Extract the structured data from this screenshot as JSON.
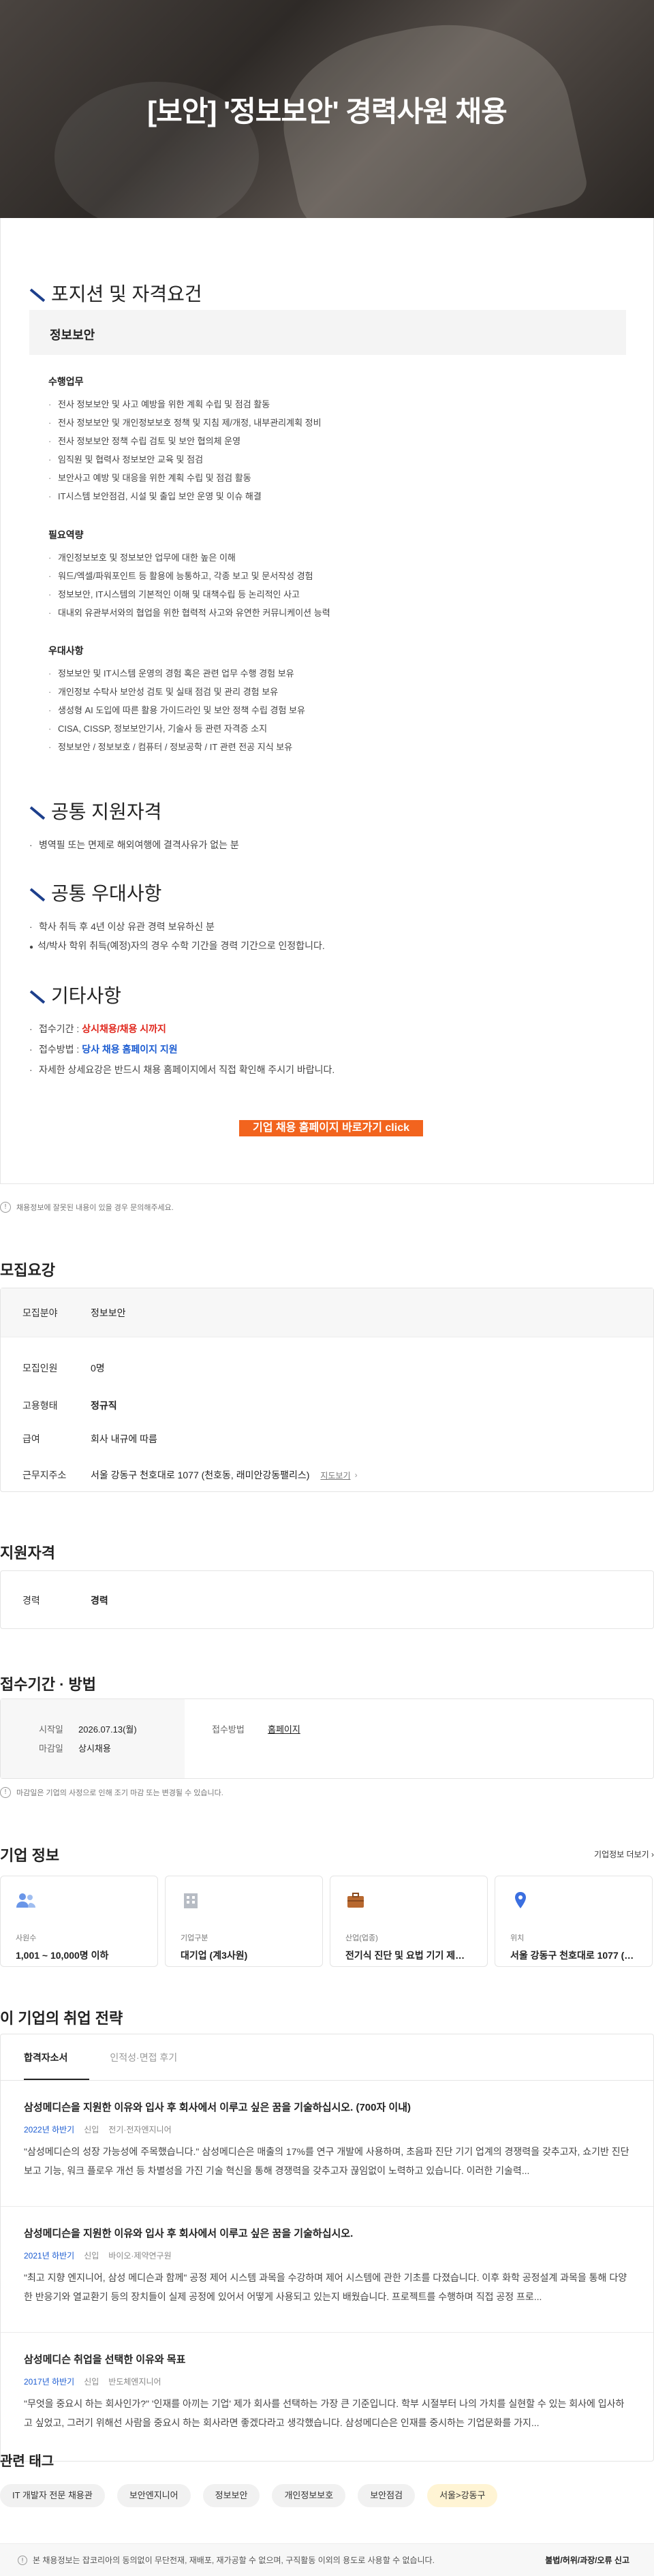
{
  "hero": {
    "title": "[보안] '정보보안' 경력사원 채용"
  },
  "jd": {
    "position_title": "포지션 및 자격요건",
    "position_name": "정보보안",
    "groups": [
      {
        "title": "수행업무",
        "items": [
          "전사 정보보안 및 사고 예방을 위한 계획 수립 및 점검 활동",
          "전사 정보보안 및 개인정보보호 정책 및 지침 제/개정, 내부관리계획 정비",
          "전사 정보보안 정책 수립 검토 및 보안 협의체 운영",
          "임직원 및 협력사 정보보안 교육 및 점검",
          "보안사고 예방 및 대응을 위한 계획 수립 및 점검 활동",
          "IT시스템 보안점검, 시설 및 출입 보안 운영 및 이슈 해결"
        ]
      },
      {
        "title": "필요역량",
        "items": [
          "개인정보보호 및 정보보안 업무에 대한 높은 이해",
          "워드/엑셀/파워포인트 등 활용에 능통하고, 각종 보고 및 문서작성 경험",
          "정보보안, IT시스템의 기본적인 이해 및 대책수립 등 논리적인 사고",
          "대내외 유관부서와의 협업을 위한 협력적 사고와 유연한 커뮤니케이션 능력"
        ]
      },
      {
        "title": "우대사항",
        "items": [
          "정보보안 및 IT시스템 운영의 경험 혹은 관련 업무 수행 경험 보유",
          "개인정보 수탁사 보안성 검토 및 실태 점검 및 관리 경험 보유",
          "생성형 AI 도입에 따른 활용 가이드라인 및 보안 정책 수립 경험 보유",
          "CISA, CISSP, 정보보안기사, 기술사 등 관련 자격증 소지",
          "정보보안 / 정보보호 / 컴퓨터 / 정보공학 / IT 관련 전공 지식 보유"
        ]
      }
    ],
    "common_req_title": "공통 지원자격",
    "common_req_items": [
      "병역필 또는 면제로 해외여행에 결격사유가 없는 분"
    ],
    "common_pref_title": "공통 우대사항",
    "common_pref_items": [
      "학사 취득 후 4년 이상 유관 경력 보유하신 분"
    ],
    "common_pref_note": "석/박사 학위 취득(예정)자의 경우 수학 기간을 경력 기간으로 인정합니다.",
    "etc_title": "기타사항",
    "etc_period_label": "접수기간 : ",
    "etc_period_value": "상시채용/채용 시까지",
    "etc_method_label": "접수방법 : ",
    "etc_method_value": "당사 채용 홈페이지 지원",
    "etc_detail": "자세한 상세요강은 반드시 채용 홈페이지에서 직접 확인해 주시기 바랍니다.",
    "cta": "기업 채용 홈페이지 바로가기 click"
  },
  "notice1": "채용정보에 잘못된 내용이 있을 경우 문의해주세요.",
  "summary": {
    "title": "모집요강",
    "rows": [
      {
        "k": "모집분야",
        "v": "정보보안"
      },
      {
        "k": "모집인원",
        "v": "0명"
      },
      {
        "k": "고용형태",
        "v": "정규직"
      },
      {
        "k": "급여",
        "v": "회사 내규에 따름"
      },
      {
        "k": "근무지주소",
        "v": "서울 강동구 천호대로 1077 (천호동, 래미안강동팰리스)",
        "link": "지도보기"
      }
    ]
  },
  "qual": {
    "title": "지원자격",
    "k": "경력",
    "v": "경력"
  },
  "period": {
    "title": "접수기간 · 방법",
    "start_label": "시작일",
    "start_value": "2026.07.13(월)",
    "end_label": "마감일",
    "end_value": "상시채용",
    "method_label": "접수방법",
    "method_value": "홈페이지"
  },
  "notice2": "마감일은 기업의 사정으로 인해 조기 마감 또는 변경될 수 있습니다.",
  "company": {
    "title": "기업 정보",
    "more": "기업정보 더보기",
    "cards": [
      {
        "icon": "people-icon",
        "label": "사원수",
        "value": "1,001 ~ 10,000명 이하"
      },
      {
        "icon": "building-icon",
        "label": "기업구분",
        "value": "대기업 (계3사원)"
      },
      {
        "icon": "briefcase-icon",
        "label": "산업(업종)",
        "value": "전기식 진단 및 요법 기기 제조업"
      },
      {
        "icon": "location-icon",
        "label": "위치",
        "value": "서울 강동구 천호대로 1077 (천..."
      }
    ]
  },
  "strategy": {
    "title": "이 기업의 취업 전략",
    "tabs": [
      "합격자소서",
      "인적성·면접 후기"
    ],
    "stories": [
      {
        "q": "삼성메디슨을 지원한 이유와 입사 후 회사에서 이루고 싶은 꿈을 기술하십시오. (700자 이내)",
        "year": "2022년 하반기",
        "type": "신입",
        "dept": "전기·전자엔지니어",
        "text": "\"삼성메디슨의 성장 가능성에 주목했습니다.\" 삼성메디슨은 매출의 17%를 연구 개발에 사용하며, 초음파 진단 기기 업계의 경쟁력을 갖추고자, 쇼기반 진단 보고 기능, 워크 플로우 개선 등 차별성을 가진 기술 혁신을 통해 경쟁력을 갖추고자 끊임없이 노력하고 있습니다. 이러한 기술력..."
      },
      {
        "q": "삼성메디슨을 지원한 이유와 입사 후 회사에서 이루고 싶은 꿈을 기술하십시오.",
        "year": "2021년 하반기",
        "type": "신입",
        "dept": "바이오·제약연구원",
        "text": "\"최고 지향 엔지니어, 삼성 메디슨과 함께\" 공정 제어 시스템 과목을 수강하며 제어 시스템에 관한 기초를 다졌습니다. 이후 화학 공정설계 과목을 통해 다양한 반응기와 열교환기 등의 장치들이 실제 공정에 있어서 어떻게 사용되고 있는지 배웠습니다. 프로젝트를 수행하며 직접 공정 프로..."
      },
      {
        "q": "삼성메디슨 취업을 선택한 이유와 목표",
        "year": "2017년 하반기",
        "type": "신입",
        "dept": "반도체엔지니어",
        "text": "\"무엇을 중요시 하는 회사인가?\" '인재를 아끼는 기업' 제가 회사를 선택하는 가장 큰 기준입니다. 학부 시절부터 나의 가치를 실현할 수 있는 회사에 입사하고 싶었고, 그러기 위해선 사람을 중요시 하는 회사라면 좋겠다라고 생각했습니다. 삼성메디슨은 인재를 중시하는 기업문화를 가지..."
      }
    ]
  },
  "tags": {
    "title": "관련 태그",
    "items": [
      "IT 개발자 전문 채용관",
      "보안엔지니어",
      "정보보안",
      "개인정보보호",
      "보안점검",
      "서울>강동구"
    ]
  },
  "footer": {
    "text": "본 채용정보는 잡코리아의 동의없이 무단전재, 재배포, 재가공할 수 없으며, 구직활동 이외의 용도로 사용할 수 없습니다.",
    "right": "불법/허위/과장/오류 신고"
  }
}
